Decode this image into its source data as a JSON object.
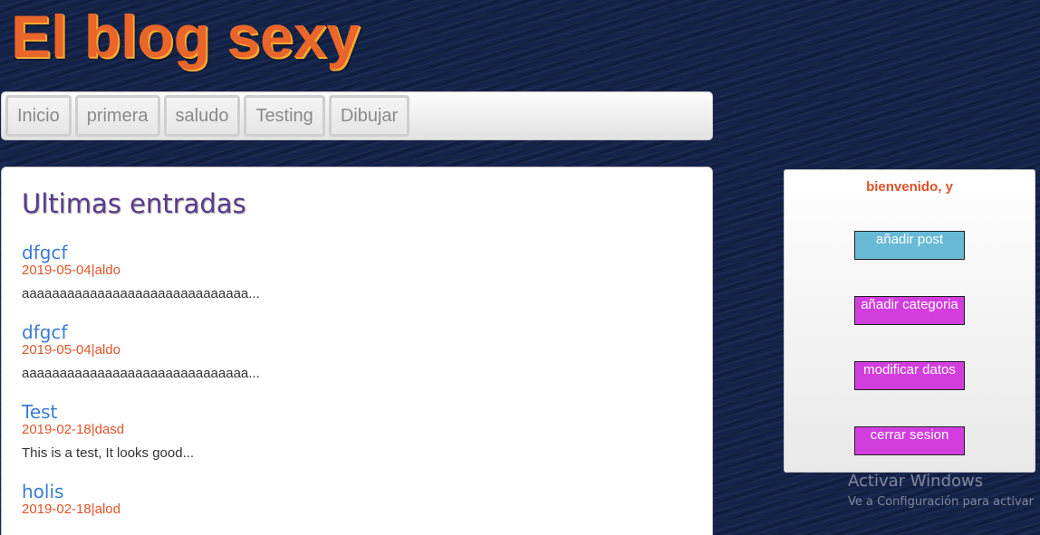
{
  "site": {
    "title": "El blog sexy"
  },
  "nav": {
    "items": [
      {
        "label": "Inicio"
      },
      {
        "label": "primera"
      },
      {
        "label": "saludo"
      },
      {
        "label": "Testing"
      },
      {
        "label": "Dibujar"
      }
    ]
  },
  "main": {
    "heading": "Ultimas entradas",
    "posts": [
      {
        "title": "dfgcf",
        "meta": "2019-05-04|aldo",
        "excerpt": "aaaaaaaaaaaaaaaaaaaaaaaaaaaaaa..."
      },
      {
        "title": "dfgcf",
        "meta": "2019-05-04|aldo",
        "excerpt": "aaaaaaaaaaaaaaaaaaaaaaaaaaaaaa..."
      },
      {
        "title": "Test",
        "meta": "2019-02-18|dasd",
        "excerpt": "This is a test, It looks good..."
      },
      {
        "title": "holis",
        "meta": "2019-02-18|alod",
        "excerpt": ""
      }
    ]
  },
  "sidebar": {
    "welcome": "bienvenido, y",
    "buttons": {
      "add_post": "añadir post",
      "add_category": "añadir categoria",
      "edit_profile": "modificar datos",
      "logout": "cerrar sesion"
    },
    "colors": {
      "add_post": "#67b9d6",
      "others": "#d23ddd"
    }
  },
  "watermark": {
    "title": "Activar Windows",
    "subtitle": "Ve a Configuración para activar"
  }
}
